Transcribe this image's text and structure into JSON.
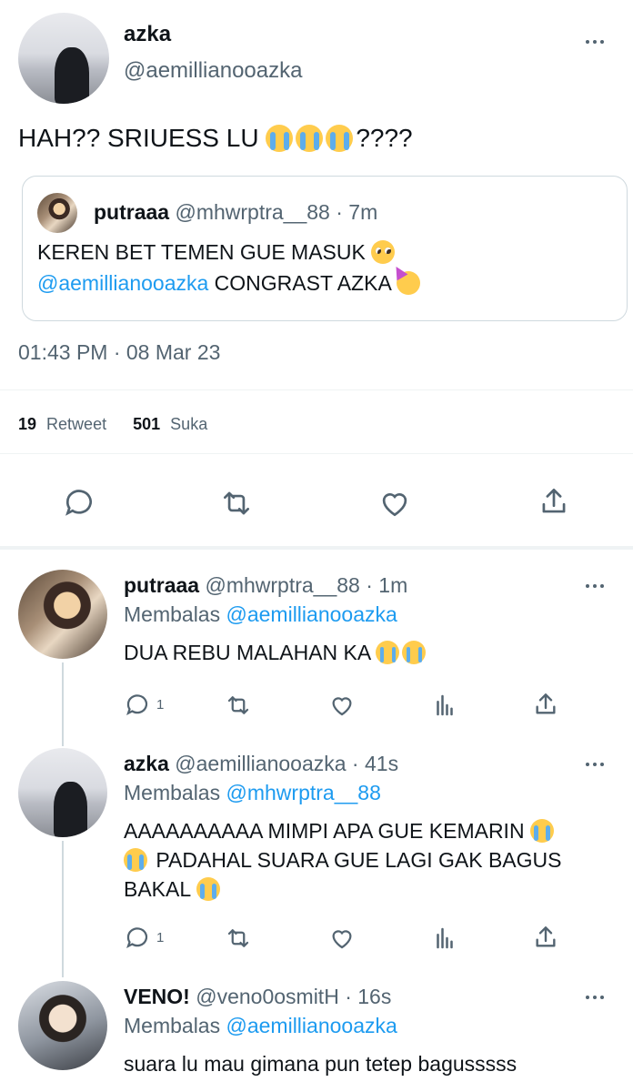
{
  "main_tweet": {
    "name": "azka",
    "handle": "@aemillianooazka",
    "text": "HAH?? SRIUESS LU",
    "text_suffix": "????",
    "timestamp": "01:43 PM · 08 Mar 23",
    "retweet_count": "19",
    "retweet_label": "Retweet",
    "like_count": "501",
    "like_label": "Suka"
  },
  "quoted": {
    "name": "putraaa",
    "handle": "@mhwrptra__88 · 7m",
    "line1": "KEREN BET TEMEN GUE MASUK",
    "mention": "@aemillianooazka",
    "line2_rest": " CONGRAST AZKA"
  },
  "replies": [
    {
      "name": "putraaa",
      "handle": "@mhwrptra__88 · 1m",
      "reply_prefix": "Membalas",
      "reply_to": "@aemillianooazka",
      "text": "DUA REBU MALAHAN KA",
      "reply_count": "1"
    },
    {
      "name": "azka",
      "handle": "@aemillianooazka · 41s",
      "reply_prefix": "Membalas",
      "reply_to": "@mhwrptra__88",
      "text_l1": "AAAAAAAAAA MIMPI APA GUE KEMARIN",
      "text_l2": "PADAHAL SUARA GUE LAGI GAK BAGUS",
      "text_l3": "BAKAL",
      "reply_count": "1"
    },
    {
      "name": "VENO!",
      "handle": "@veno0osmitH · 16s",
      "reply_prefix": "Membalas",
      "reply_to": "@aemillianooazka",
      "text": "suara lu mau gimana pun tetep bagusssss"
    }
  ],
  "icons": [
    "reply-icon",
    "retweet-icon",
    "like-icon",
    "share-icon",
    "analytics-icon",
    "more-icon"
  ],
  "colors": {
    "link": "#1d9bf0",
    "muted": "#536471",
    "border": "#cfd9de"
  }
}
